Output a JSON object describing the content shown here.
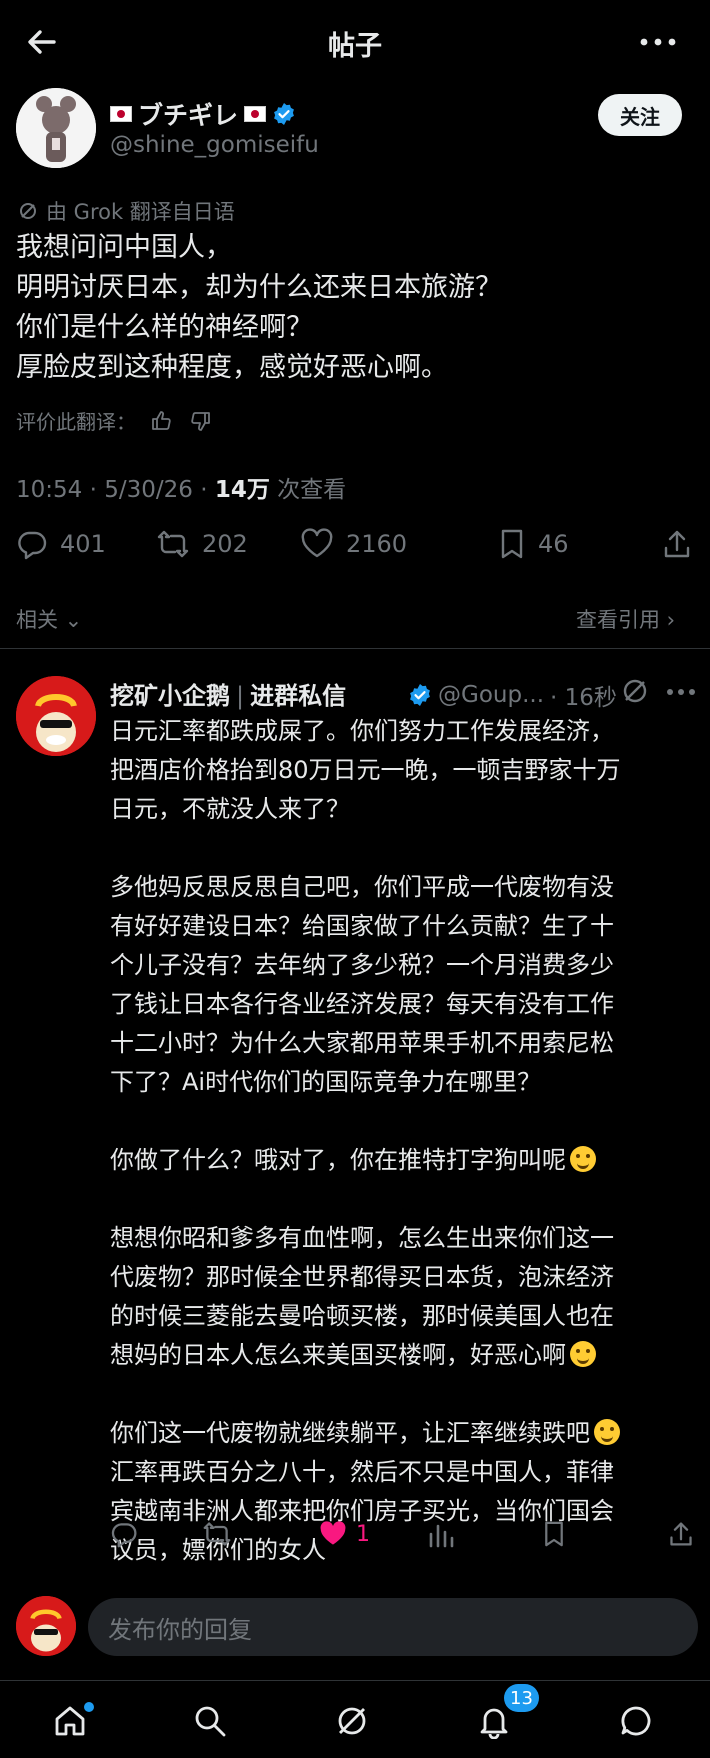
{
  "header": {
    "title": "帖子"
  },
  "post": {
    "author_name": "ブチギレ",
    "author_handle": "@shine_gomiseifu",
    "follow_label": "关注",
    "grok_note": "由 Grok 翻译自日语",
    "lines": [
      "我想问问中国人，",
      "明明讨厌日本，却为什么还来日本旅游？",
      "你们是什么样的神经啊？",
      "厚脸皮到这种程度，感觉好恶心啊。"
    ],
    "rate_label": "评价此翻译：",
    "time": "10:54 · 5/30/26 · ",
    "views": "14万",
    "views_label": " 次查看",
    "stats": {
      "replies": "401",
      "reposts": "202",
      "likes": "2160",
      "bookmarks": "46"
    },
    "related": "相关",
    "view_quotes": "查看引用"
  },
  "reply": {
    "author_name": "挖矿小企鹅",
    "separator": "|",
    "author_tag": "进群私信",
    "author_handle": "@Goup...",
    "time": "· 16秒",
    "lines": [
      "日元汇率都跌成屎了。你们努力工作发展经济，",
      "把酒店价格抬到80万日元一晚，一顿吉野家十万",
      "日元，不就没人来了？",
      "",
      "多他妈反思反思自己吧，你们平成一代废物有没",
      "有好好建设日本？给国家做了什么贡献？生了十",
      "个儿子没有？去年纳了多少税？一个月消费多少",
      "了钱让日本各行各业经济发展？每天有没有工作",
      "十二小时？为什么大家都用苹果手机不用索尼松",
      "下了？Ai时代你们的国际竞争力在哪里？",
      "",
      "你做了什么？哦对了，你在推特打字狗叫呢",
      "",
      "想想你昭和爹多有血性啊，怎么生出来你们这一",
      "代废物？那时候全世界都得买日本货，泡沫经济",
      "的时候三菱能去曼哈顿买楼，那时候美国人也在",
      "想妈的日本人怎么来美国买楼啊，好恶心啊",
      "",
      "你们这一代废物就继续躺平，让汇率继续跌吧",
      "汇率再跌百分之八十，然后不只是中国人，菲律",
      "宾越南非洲人都来把你们房子买光，当你们国会",
      "议员，嫖你们的女人"
    ],
    "emoji_lines": [
      11,
      16,
      18
    ],
    "likes": "1",
    "like_color": "#f91880"
  },
  "composer": {
    "placeholder": "发布你的回复"
  },
  "nav": {
    "notification_count": "13"
  },
  "colors": {
    "accent": "#1d9bf0",
    "muted": "#71767b",
    "text": "#e7e9ea"
  }
}
